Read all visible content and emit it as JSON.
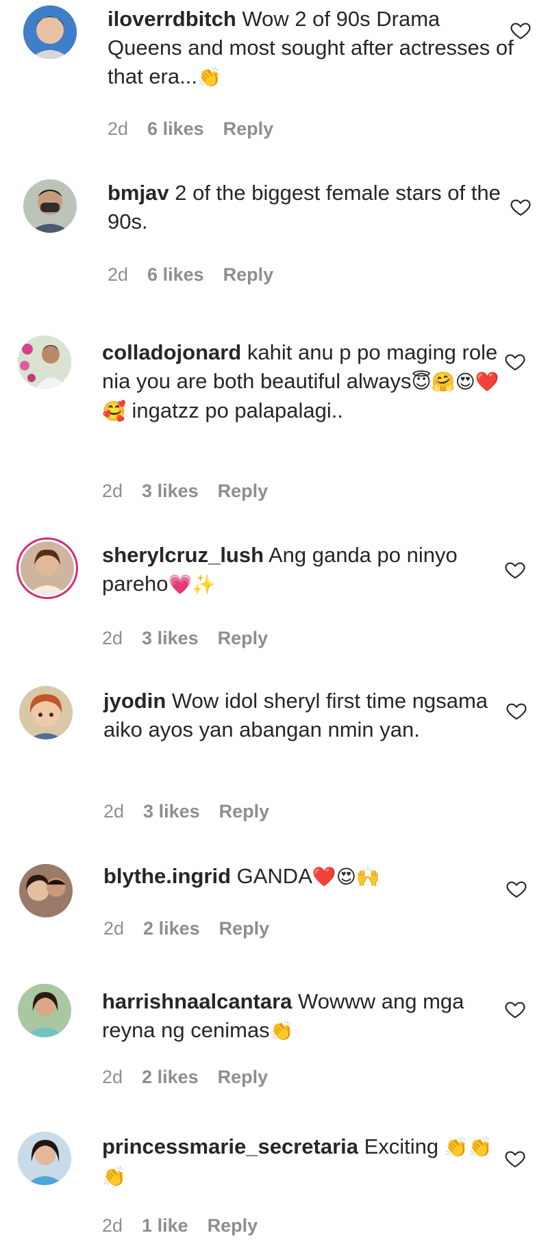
{
  "colors": {
    "text": "#262626",
    "meta": "#8e8e8e",
    "story_ring": "#d62976"
  },
  "comments": [
    {
      "username": "iloverrdbitch",
      "text": "Wow 2 of 90s Drama Queens and most sought after actresses of that era...",
      "emoji": "👏",
      "time": "2d",
      "likes": "6 likes",
      "reply": "Reply",
      "avatar_icon": "avatar-icon"
    },
    {
      "username": "bmjav",
      "text": "2 of the biggest female stars of the 90s.",
      "emoji": "",
      "time": "2d",
      "likes": "6 likes",
      "reply": "Reply",
      "avatar_icon": "avatar-icon"
    },
    {
      "username": "colladojonard",
      "text": "kahit anu p po maging role nia you are both beautiful always",
      "emoji": "😇🤗😍❤️🥰",
      "text2": " ingatzz po palapalagi..",
      "time": "2d",
      "likes": "3 likes",
      "reply": "Reply",
      "avatar_icon": "avatar-icon"
    },
    {
      "username": "sherylcruz_lush",
      "text": "Ang ganda po ninyo pareho",
      "emoji": "💗✨",
      "time": "2d",
      "likes": "3 likes",
      "reply": "Reply",
      "avatar_icon": "avatar-icon"
    },
    {
      "username": "jyodin",
      "text": "Wow idol sheryl first time ngsama aiko ayos yan abangan nmin yan.",
      "emoji": "",
      "time": "2d",
      "likes": "3 likes",
      "reply": "Reply",
      "avatar_icon": "avatar-icon"
    },
    {
      "username": "blythe.ingrid",
      "text": "GANDA",
      "emoji": "❤️😍🙌",
      "time": "2d",
      "likes": "2 likes",
      "reply": "Reply",
      "avatar_icon": "avatar-icon"
    },
    {
      "username": "harrishnaalcantara",
      "text": "Wowww ang mga reyna ng cenimas",
      "emoji": "👏",
      "time": "2d",
      "likes": "2 likes",
      "reply": "Reply",
      "avatar_icon": "avatar-icon"
    },
    {
      "username": "princessmarie_secretaria",
      "text": "Exciting",
      "emoji": "👏👏👏",
      "time": "2d",
      "likes": "1 like",
      "reply": "Reply",
      "avatar_icon": "avatar-icon"
    }
  ]
}
